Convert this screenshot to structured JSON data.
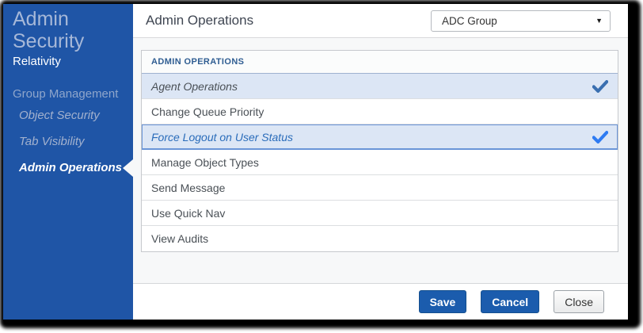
{
  "sidebar": {
    "title": "Admin Security",
    "subtitle": "Relativity",
    "group_label": "Group Management",
    "items": [
      {
        "label": "Object Security",
        "active": false
      },
      {
        "label": "Tab Visibility",
        "active": false
      },
      {
        "label": "Admin Operations",
        "active": true
      }
    ]
  },
  "header": {
    "title": "Admin Operations",
    "group_select": {
      "value": "ADC Group",
      "caret": "▼"
    }
  },
  "table": {
    "header": "ADMIN OPERATIONS",
    "rows": [
      {
        "label": "Agent Operations",
        "checked": true,
        "selected": true
      },
      {
        "label": "Change Queue Priority",
        "checked": false
      },
      {
        "label": "Force Logout on User Status",
        "checked": true,
        "selected": true,
        "focused": true
      },
      {
        "label": "Manage Object Types",
        "checked": false
      },
      {
        "label": "Send Message",
        "checked": false
      },
      {
        "label": "Use Quick Nav",
        "checked": false
      },
      {
        "label": "View Audits",
        "checked": false
      }
    ]
  },
  "footer": {
    "save_label": "Save",
    "cancel_label": "Cancel",
    "close_label": "Close"
  },
  "colors": {
    "sidebar_bg": "#1F55A6",
    "accent_blue": "#1B5CAD",
    "selected_row_bg": "#DCE6F5",
    "focused_row_border": "#6A95D8",
    "focused_row_text": "#2A6CBA",
    "check_muted": "#3A6FB0",
    "check_bright": "#2E7BF2",
    "table_header_text": "#2F5D92"
  }
}
